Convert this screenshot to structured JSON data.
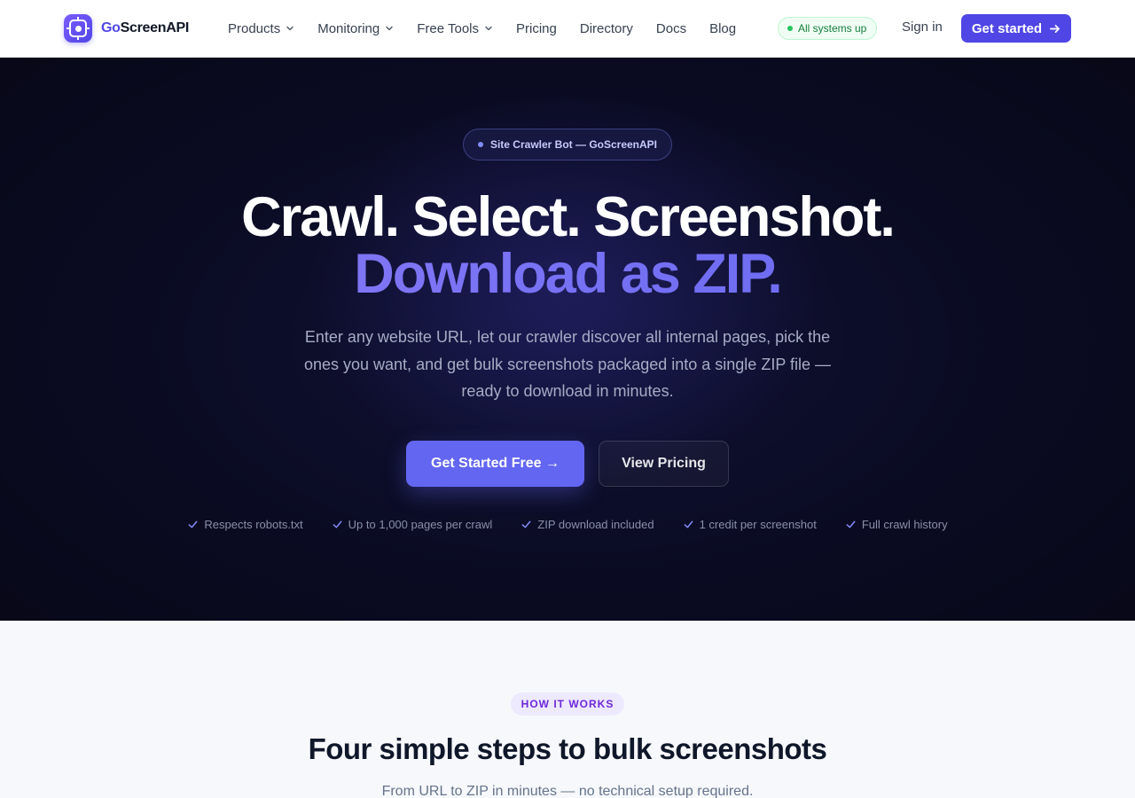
{
  "nav": {
    "logo_prefix": "Go",
    "logo_suffix": "ScreenAPI",
    "links": [
      {
        "label": "Products",
        "dropdown": true
      },
      {
        "label": "Monitoring",
        "dropdown": true
      },
      {
        "label": "Free Tools",
        "dropdown": true
      },
      {
        "label": "Pricing",
        "dropdown": false
      },
      {
        "label": "Directory",
        "dropdown": false
      },
      {
        "label": "Docs",
        "dropdown": false
      },
      {
        "label": "Blog",
        "dropdown": false
      }
    ],
    "status": "All systems up",
    "signin": "Sign in",
    "cta": "Get started"
  },
  "hero": {
    "badge": "Site Crawler Bot — GoScreenAPI",
    "title_line1": "Crawl. Select. Screenshot.",
    "title_line2": "Download as ZIP.",
    "subtitle": "Enter any website URL, let our crawler discover all internal pages, pick the ones you want, and get bulk screenshots packaged into a single ZIP file — ready to download in minutes.",
    "primary_button": "Get Started Free →",
    "secondary_button": "View Pricing",
    "features": [
      "Respects robots.txt",
      "Up to 1,000 pages per crawl",
      "ZIP download included",
      "1 credit per screenshot",
      "Full crawl history"
    ]
  },
  "how": {
    "pill": "HOW IT WORKS",
    "title": "Four simple steps to bulk screenshots",
    "subtitle": "From URL to ZIP in minutes — no technical setup required."
  },
  "colors": {
    "brand": "#4f46e5",
    "accent": "#6366f1",
    "hero_bg": "#0a0b22",
    "status_green": "#22c55e"
  }
}
